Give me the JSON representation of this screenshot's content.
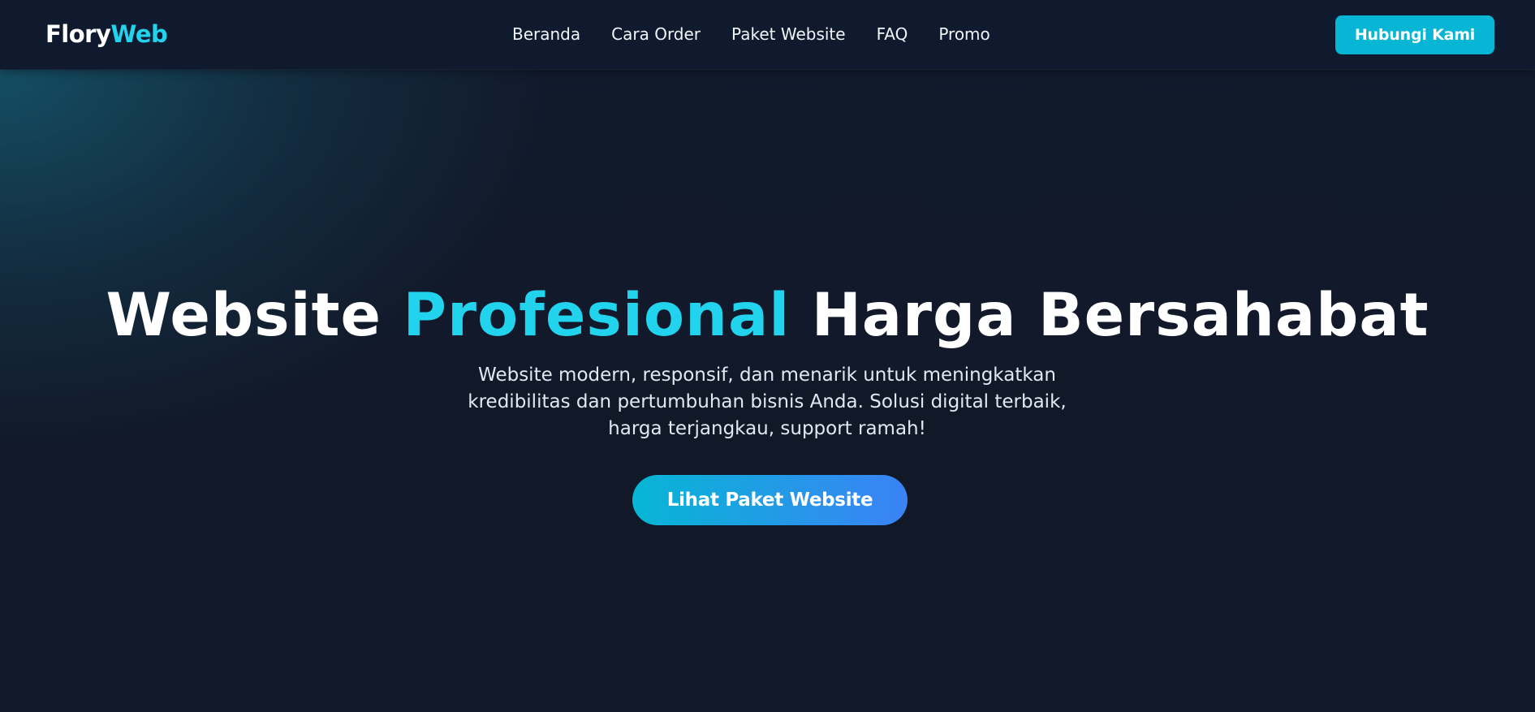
{
  "navbar": {
    "logo_main": "Flory",
    "logo_accent": "Web",
    "links": [
      "Beranda",
      "Cara Order",
      "Paket Website",
      "FAQ",
      "Promo"
    ],
    "contact_label": "Hubungi Kami"
  },
  "hero": {
    "title_part1": "Website ",
    "title_accent": "Profesional",
    "title_part2": " Harga Bersahabat",
    "subtitle": "Website modern, responsif, dan menarik untuk meningkatkan kredibilitas dan pertumbuhan bisnis Anda. Solusi digital terbaik, harga terjangkau, support ramah!",
    "cta_label": "Lihat Paket Website"
  },
  "colors": {
    "accent": "#22d3ee",
    "button_primary": "#06b6d4",
    "gradient_end": "#3b82f6",
    "background": "#111827"
  }
}
